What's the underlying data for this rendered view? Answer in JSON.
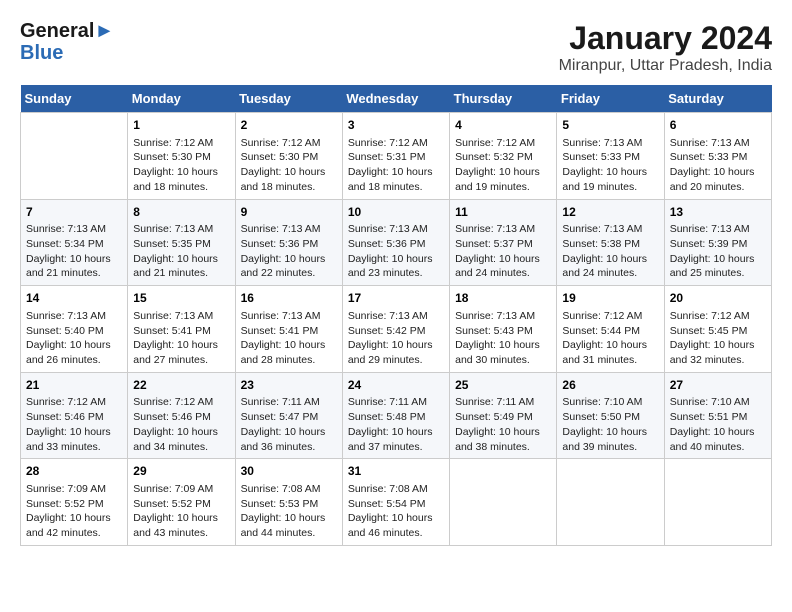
{
  "header": {
    "logo_line1": "General",
    "logo_line2": "Blue",
    "title": "January 2024",
    "subtitle": "Miranpur, Uttar Pradesh, India"
  },
  "days_of_week": [
    "Sunday",
    "Monday",
    "Tuesday",
    "Wednesday",
    "Thursday",
    "Friday",
    "Saturday"
  ],
  "weeks": [
    [
      {
        "day": "",
        "content": ""
      },
      {
        "day": "1",
        "content": "Sunrise: 7:12 AM\nSunset: 5:30 PM\nDaylight: 10 hours\nand 18 minutes."
      },
      {
        "day": "2",
        "content": "Sunrise: 7:12 AM\nSunset: 5:30 PM\nDaylight: 10 hours\nand 18 minutes."
      },
      {
        "day": "3",
        "content": "Sunrise: 7:12 AM\nSunset: 5:31 PM\nDaylight: 10 hours\nand 18 minutes."
      },
      {
        "day": "4",
        "content": "Sunrise: 7:12 AM\nSunset: 5:32 PM\nDaylight: 10 hours\nand 19 minutes."
      },
      {
        "day": "5",
        "content": "Sunrise: 7:13 AM\nSunset: 5:33 PM\nDaylight: 10 hours\nand 19 minutes."
      },
      {
        "day": "6",
        "content": "Sunrise: 7:13 AM\nSunset: 5:33 PM\nDaylight: 10 hours\nand 20 minutes."
      }
    ],
    [
      {
        "day": "7",
        "content": "Sunrise: 7:13 AM\nSunset: 5:34 PM\nDaylight: 10 hours\nand 21 minutes."
      },
      {
        "day": "8",
        "content": "Sunrise: 7:13 AM\nSunset: 5:35 PM\nDaylight: 10 hours\nand 21 minutes."
      },
      {
        "day": "9",
        "content": "Sunrise: 7:13 AM\nSunset: 5:36 PM\nDaylight: 10 hours\nand 22 minutes."
      },
      {
        "day": "10",
        "content": "Sunrise: 7:13 AM\nSunset: 5:36 PM\nDaylight: 10 hours\nand 23 minutes."
      },
      {
        "day": "11",
        "content": "Sunrise: 7:13 AM\nSunset: 5:37 PM\nDaylight: 10 hours\nand 24 minutes."
      },
      {
        "day": "12",
        "content": "Sunrise: 7:13 AM\nSunset: 5:38 PM\nDaylight: 10 hours\nand 24 minutes."
      },
      {
        "day": "13",
        "content": "Sunrise: 7:13 AM\nSunset: 5:39 PM\nDaylight: 10 hours\nand 25 minutes."
      }
    ],
    [
      {
        "day": "14",
        "content": "Sunrise: 7:13 AM\nSunset: 5:40 PM\nDaylight: 10 hours\nand 26 minutes."
      },
      {
        "day": "15",
        "content": "Sunrise: 7:13 AM\nSunset: 5:41 PM\nDaylight: 10 hours\nand 27 minutes."
      },
      {
        "day": "16",
        "content": "Sunrise: 7:13 AM\nSunset: 5:41 PM\nDaylight: 10 hours\nand 28 minutes."
      },
      {
        "day": "17",
        "content": "Sunrise: 7:13 AM\nSunset: 5:42 PM\nDaylight: 10 hours\nand 29 minutes."
      },
      {
        "day": "18",
        "content": "Sunrise: 7:13 AM\nSunset: 5:43 PM\nDaylight: 10 hours\nand 30 minutes."
      },
      {
        "day": "19",
        "content": "Sunrise: 7:12 AM\nSunset: 5:44 PM\nDaylight: 10 hours\nand 31 minutes."
      },
      {
        "day": "20",
        "content": "Sunrise: 7:12 AM\nSunset: 5:45 PM\nDaylight: 10 hours\nand 32 minutes."
      }
    ],
    [
      {
        "day": "21",
        "content": "Sunrise: 7:12 AM\nSunset: 5:46 PM\nDaylight: 10 hours\nand 33 minutes."
      },
      {
        "day": "22",
        "content": "Sunrise: 7:12 AM\nSunset: 5:46 PM\nDaylight: 10 hours\nand 34 minutes."
      },
      {
        "day": "23",
        "content": "Sunrise: 7:11 AM\nSunset: 5:47 PM\nDaylight: 10 hours\nand 36 minutes."
      },
      {
        "day": "24",
        "content": "Sunrise: 7:11 AM\nSunset: 5:48 PM\nDaylight: 10 hours\nand 37 minutes."
      },
      {
        "day": "25",
        "content": "Sunrise: 7:11 AM\nSunset: 5:49 PM\nDaylight: 10 hours\nand 38 minutes."
      },
      {
        "day": "26",
        "content": "Sunrise: 7:10 AM\nSunset: 5:50 PM\nDaylight: 10 hours\nand 39 minutes."
      },
      {
        "day": "27",
        "content": "Sunrise: 7:10 AM\nSunset: 5:51 PM\nDaylight: 10 hours\nand 40 minutes."
      }
    ],
    [
      {
        "day": "28",
        "content": "Sunrise: 7:09 AM\nSunset: 5:52 PM\nDaylight: 10 hours\nand 42 minutes."
      },
      {
        "day": "29",
        "content": "Sunrise: 7:09 AM\nSunset: 5:52 PM\nDaylight: 10 hours\nand 43 minutes."
      },
      {
        "day": "30",
        "content": "Sunrise: 7:08 AM\nSunset: 5:53 PM\nDaylight: 10 hours\nand 44 minutes."
      },
      {
        "day": "31",
        "content": "Sunrise: 7:08 AM\nSunset: 5:54 PM\nDaylight: 10 hours\nand 46 minutes."
      },
      {
        "day": "",
        "content": ""
      },
      {
        "day": "",
        "content": ""
      },
      {
        "day": "",
        "content": ""
      }
    ]
  ]
}
